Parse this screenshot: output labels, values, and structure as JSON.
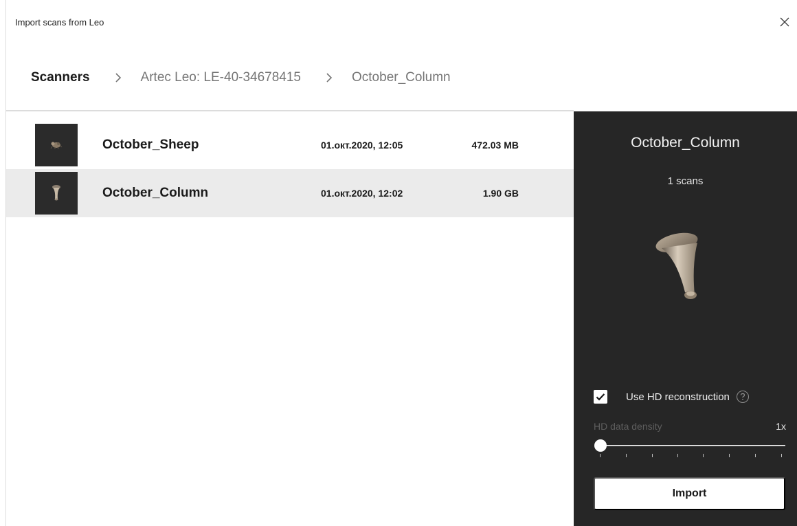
{
  "window": {
    "title": "Import scans from Leo"
  },
  "breadcrumb": {
    "items": [
      {
        "label": "Scanners"
      },
      {
        "label": "Artec Leo: LE-40-34678415"
      },
      {
        "label": "October_Column"
      }
    ]
  },
  "scans": [
    {
      "name": "October_Sheep",
      "date": "01.окт.2020, 12:05",
      "size": "472.03 MB",
      "selected": false
    },
    {
      "name": "October_Column",
      "date": "01.окт.2020, 12:02",
      "size": "1.90 GB",
      "selected": true
    }
  ],
  "details": {
    "title": "October_Column",
    "scan_count": "1 scans",
    "hd_reconstruction": {
      "label": "Use HD reconstruction",
      "checked": true
    },
    "hd_density": {
      "label": "HD data density",
      "value": "1x",
      "level": 0
    },
    "import_label": "Import"
  },
  "colors": {
    "panel_bg": "#262626",
    "selected_row": "#ebebeb",
    "breadcrumb_muted": "#757575"
  },
  "icons": [
    "close-icon",
    "chevron-right-icon",
    "checkmark-icon",
    "help-icon"
  ]
}
